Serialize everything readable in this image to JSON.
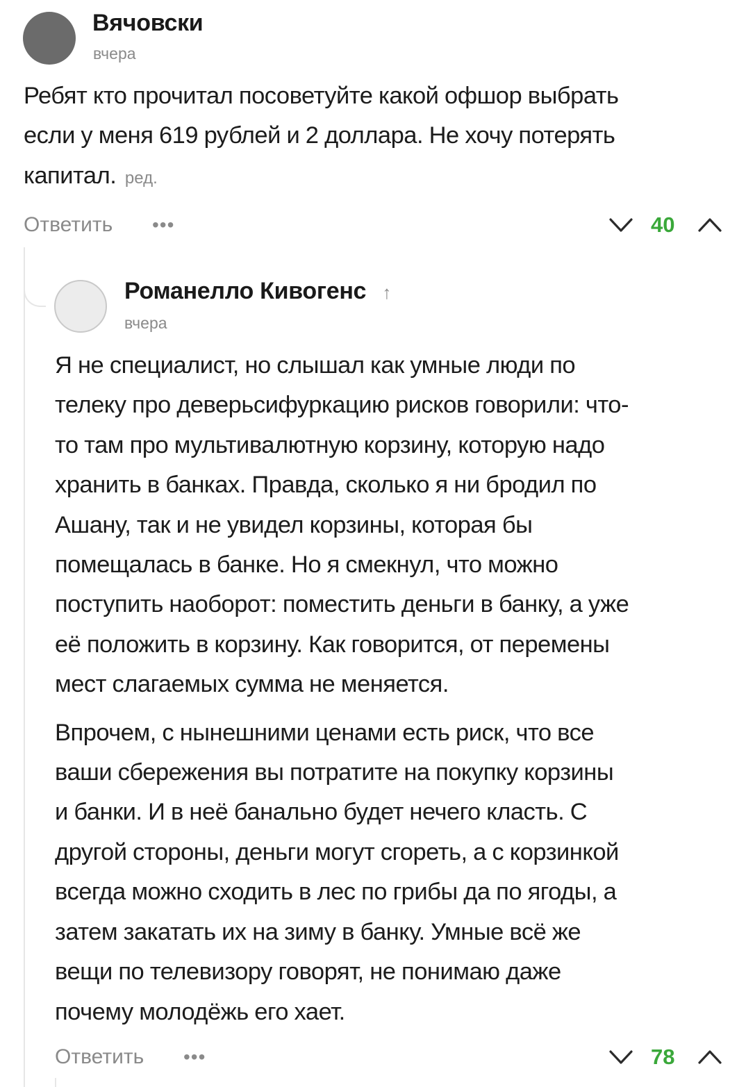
{
  "comment1": {
    "author": "Вячовски",
    "time": "вчера",
    "lines": [
      "Ребят кто прочитал посоветуйте какой офшор выбрать",
      "если у меня 619 рублей и 2 доллара. Не хочу потерять",
      "капитал."
    ],
    "edited_label": "ред.",
    "reply_label": "Ответить",
    "more_label": "•••",
    "votes": "40"
  },
  "comment2": {
    "author": "Романелло Кивогенс",
    "author_arrow": "↑",
    "time": "вчера",
    "paragraph1": [
      "Я не специалист, но слышал как умные люди по",
      "телеку про деверьсифуркацию рисков говорили: что-",
      "то там про мультивалютную корзину, которую надо",
      "хранить в банках. Правда, сколько я ни бродил по",
      "Ашану, так и не увидел корзины, которая бы",
      "помещалась в банке. Но я смекнул, что можно",
      "поступить наоборот: поместить деньги в банку, а уже",
      "её положить в корзину. Как говорится, от перемены",
      "мест слагаемых сумма не меняется."
    ],
    "paragraph2": [
      "Впрочем, с нынешними ценами есть риск, что все",
      "ваши сбережения вы потратите на покупку корзины",
      "и банки. И в неё банально будет нечего класть. С",
      "другой стороны, деньги могут сгореть, а с корзинкой",
      "всегда можно сходить в лес по грибы да по ягоды, а",
      "затем закатать их на зиму в банку. Умные всё же",
      "вещи по телевизору говорят, не понимаю даже",
      "почему молодёжь его хает."
    ],
    "reply_label": "Ответить",
    "more_label": "•••",
    "votes": "78"
  },
  "colors": {
    "vote_positive": "#3aa83a",
    "muted_text": "#8a8a8a",
    "thread_line": "#e6e6e6"
  },
  "icons": {
    "vote_down": "chevron-down-icon",
    "vote_up": "chevron-up-icon",
    "author_arrow": "arrow-up-icon"
  }
}
